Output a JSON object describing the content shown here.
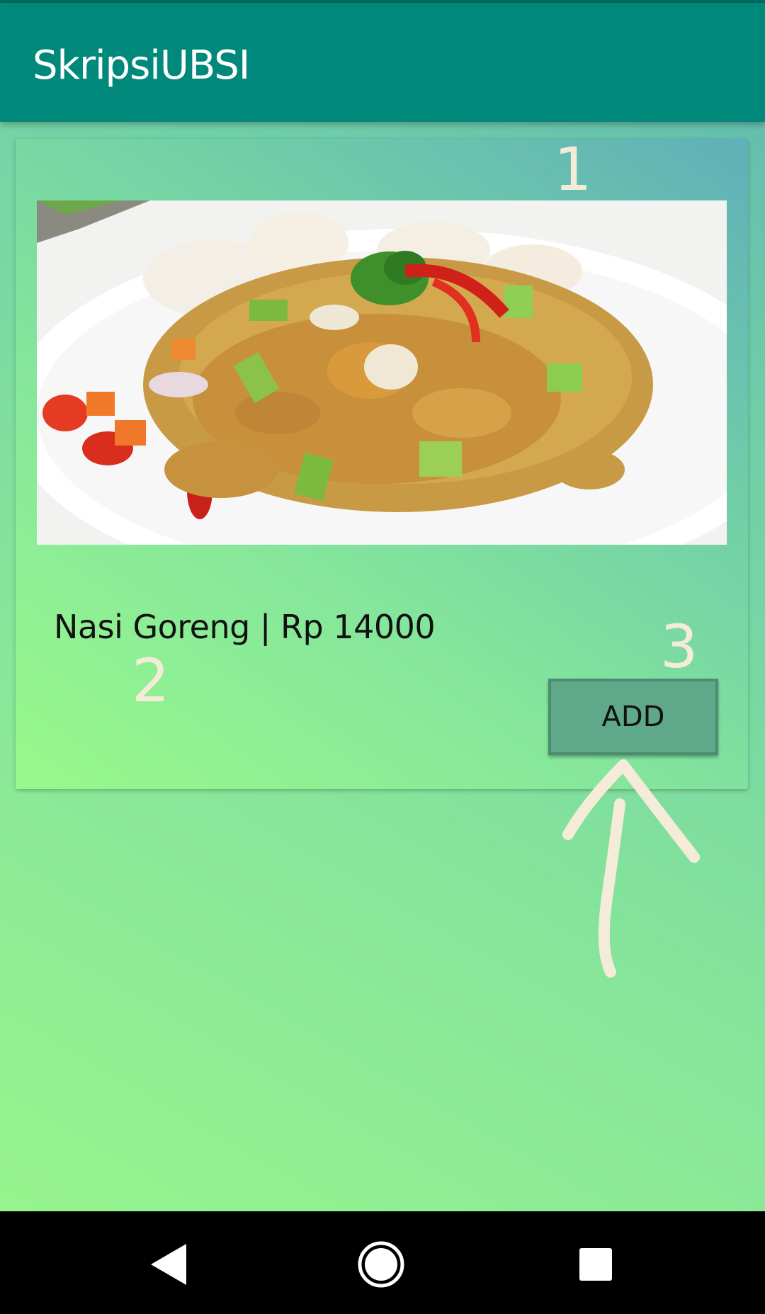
{
  "app": {
    "title": "SkripsiUBSI"
  },
  "annotations": {
    "one": "1",
    "two": "2",
    "three": "3"
  },
  "item": {
    "title": "Nasi Goreng | Rp 14000",
    "image_icon": "fried-rice-photo",
    "add_label": "ADD"
  },
  "navigation": {
    "back_icon": "back-triangle-icon",
    "home_icon": "home-circle-icon",
    "recents_icon": "recents-square-icon"
  },
  "colors": {
    "appbar": "#00897b",
    "button": "#5fa98a",
    "annotation": "#f4ecd8"
  }
}
